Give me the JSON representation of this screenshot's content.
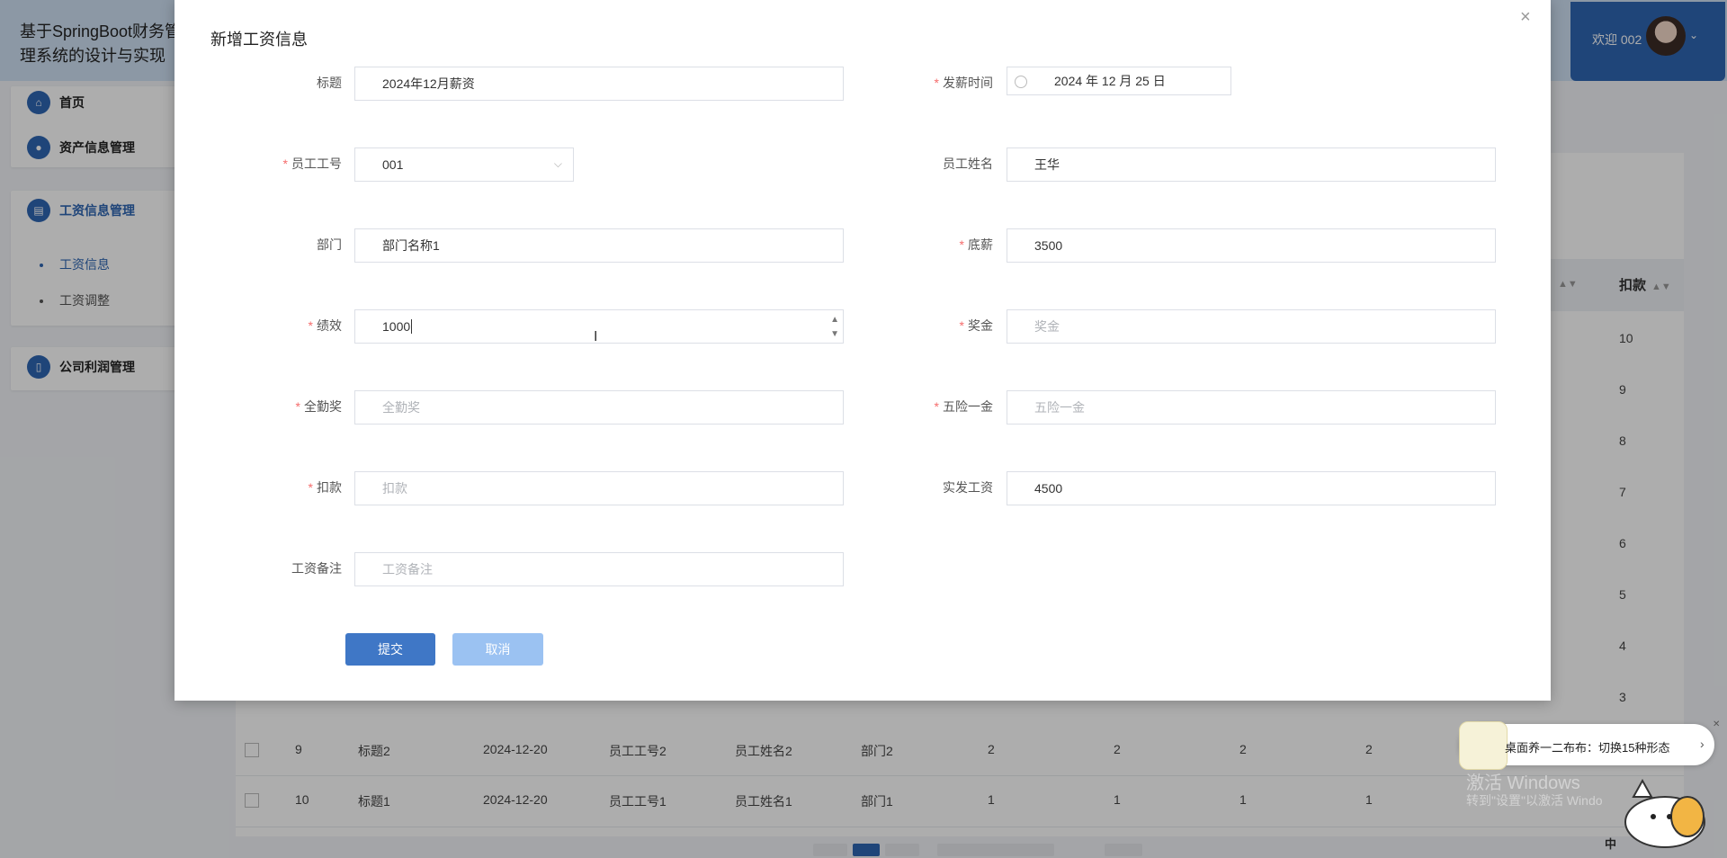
{
  "app": {
    "title": "基于SpringBoot财务管理系统的设计与实现",
    "welcome": "欢迎 002",
    "sidebar": [
      {
        "label": "首页"
      },
      {
        "label": "资产信息管理"
      },
      {
        "label": "工资信息管理",
        "children": [
          {
            "label": "工资信息",
            "active": true
          },
          {
            "label": "工资调整"
          }
        ]
      },
      {
        "label": "公司利润管理"
      }
    ],
    "table": {
      "visible_header": "扣款",
      "deductions_column": [
        "10",
        "9",
        "8",
        "7",
        "6",
        "5",
        "4",
        "3"
      ],
      "rows": [
        {
          "id": "9",
          "title": "标题2",
          "date": "2024-12-20",
          "emp_no": "员工工号2",
          "emp_name": "员工姓名2",
          "dept": "部门2",
          "v1": "2",
          "v2": "2",
          "v3": "2",
          "v4": "2"
        },
        {
          "id": "10",
          "title": "标题1",
          "date": "2024-12-20",
          "emp_no": "员工工号1",
          "emp_name": "员工姓名1",
          "dept": "部门1",
          "v1": "1",
          "v2": "1",
          "v3": "1",
          "v4": "1"
        }
      ]
    }
  },
  "dialog": {
    "title": "新增工资信息",
    "close": "×",
    "fields": {
      "title": {
        "label": "标题",
        "value": "2024年12月薪资"
      },
      "pay_time": {
        "label": "发薪时间",
        "value": "2024 年 12 月 25 日"
      },
      "emp_no": {
        "label": "员工工号",
        "value": "001"
      },
      "emp_name": {
        "label": "员工姓名",
        "value": "王华"
      },
      "dept": {
        "label": "部门",
        "value": "部门名称1"
      },
      "base": {
        "label": "底薪",
        "value": "3500"
      },
      "perf": {
        "label": "绩效",
        "value": "1000"
      },
      "bonus": {
        "label": "奖金",
        "placeholder": "奖金"
      },
      "attendance": {
        "label": "全勤奖",
        "placeholder": "全勤奖"
      },
      "insurance": {
        "label": "五险一金",
        "placeholder": "五险一金"
      },
      "deduct": {
        "label": "扣款",
        "placeholder": "扣款"
      },
      "net": {
        "label": "实发工资",
        "value": "4500"
      },
      "remark": {
        "label": "工资备注",
        "placeholder": "工资备注"
      }
    },
    "buttons": {
      "submit": "提交",
      "cancel": "取消"
    }
  },
  "desktop": {
    "toast": "桌面养一二布布：切换15种形态",
    "watermark1": "激活 Windows",
    "watermark2": "转到\"设置\"以激活 Windo",
    "ime": "中"
  }
}
